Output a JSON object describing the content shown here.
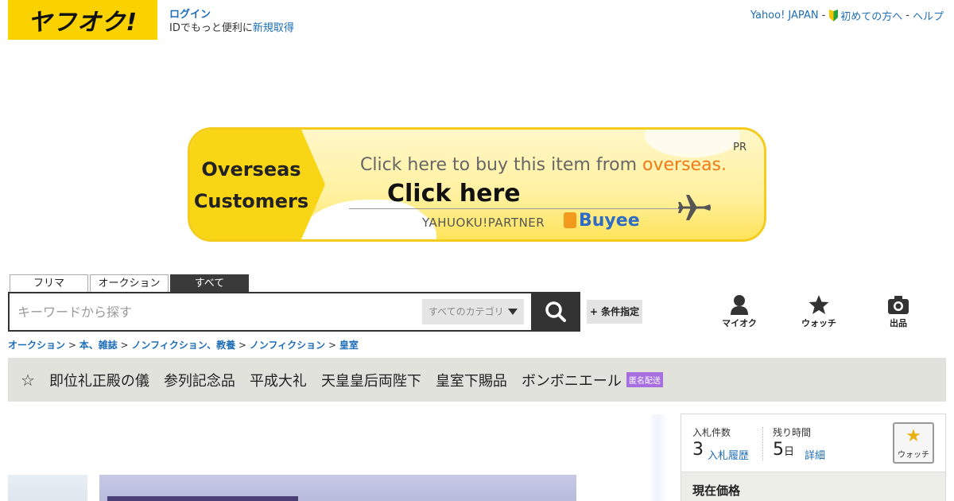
{
  "header": {
    "logo_text": "ヤフオク!",
    "login_label": "ログイン",
    "id_text": "IDでもっと便利に",
    "signup_label": "新規取得",
    "links": [
      {
        "label": "Yahoo! JAPAN",
        "sep": "-"
      },
      {
        "label": "初めての方へ",
        "sep": "-",
        "icon": "beginner-mark-icon"
      },
      {
        "label": "ヘルプ",
        "sep": ""
      }
    ]
  },
  "banner": {
    "left_line1": "Overseas",
    "left_line2": "Customers",
    "pr": "PR",
    "headline_pre": "Click here to buy this item from ",
    "headline_hl": "overseas.",
    "cta": "Click here",
    "partner": "YAHUOKU!PARTNER",
    "brand": "Buyee",
    "colors": {
      "yellow": "#f8d616",
      "orange": "#ef7a16",
      "blue": "#2f6cc3"
    }
  },
  "search": {
    "tabs": [
      {
        "label": "フリマ",
        "active": false
      },
      {
        "label": "オークション",
        "active": false
      },
      {
        "label": "すべて",
        "active": true
      }
    ],
    "placeholder": "キーワードから探す",
    "category": "すべてのカテゴリ",
    "condition_button": "+ 条件指定",
    "search_icon": "search-icon"
  },
  "nav": [
    {
      "label": "マイオク",
      "icon": "user-icon"
    },
    {
      "label": "ウォッチ",
      "icon": "star-icon"
    },
    {
      "label": "出品",
      "icon": "camera-icon"
    }
  ],
  "breadcrumb": [
    {
      "label": "オークション"
    },
    {
      "label": "本、雑誌"
    },
    {
      "label": "ノンフィクション、教養"
    },
    {
      "label": "ノンフィクション"
    },
    {
      "label": "皇室"
    }
  ],
  "tagbar": {
    "star": "☆",
    "tags": [
      "即位礼正殿の儀",
      "参列記念品",
      "平成大礼",
      "天皇皇后両陛下",
      "皇室下賜品",
      "ボンボニエール"
    ],
    "badge": "匿名配送",
    "badge_color": "#a76ee0"
  },
  "bid_panel": {
    "bids_label": "入札件数",
    "bids_value": "3",
    "history_link": "入札履歴",
    "time_label": "残り時間",
    "time_value": "5",
    "time_unit": "日",
    "detail_link": "詳細",
    "watch_label": "ウォッチ",
    "price_head": "現在価格"
  }
}
